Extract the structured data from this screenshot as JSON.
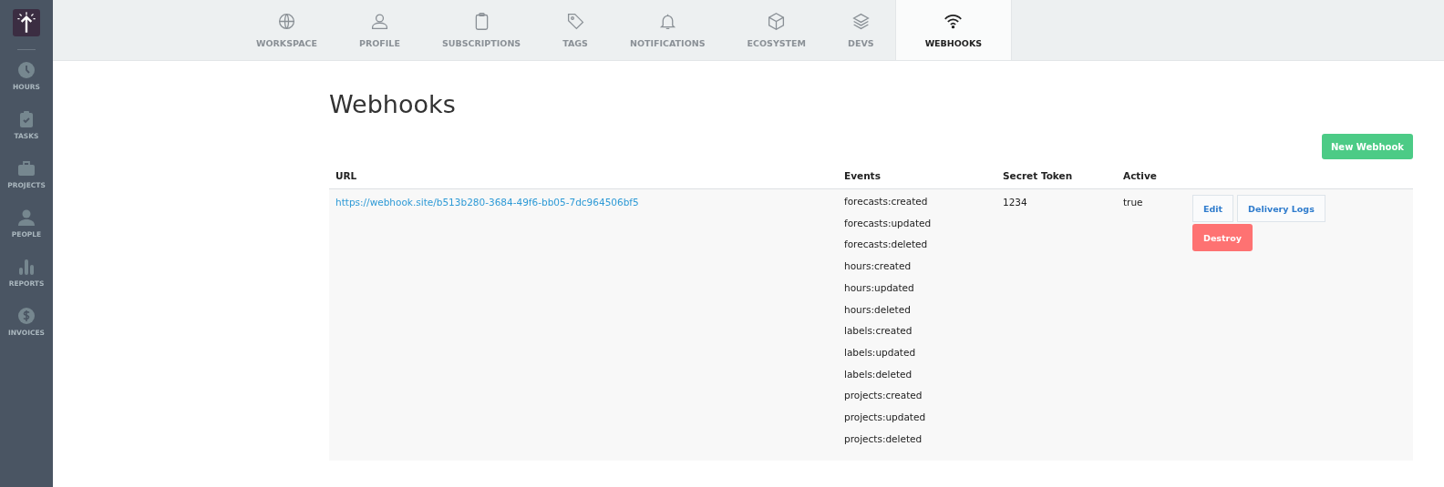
{
  "sidebar": {
    "items": [
      {
        "label": "HOURS"
      },
      {
        "label": "TASKS"
      },
      {
        "label": "PROJECTS"
      },
      {
        "label": "PEOPLE"
      },
      {
        "label": "REPORTS"
      },
      {
        "label": "INVOICES"
      }
    ]
  },
  "tabs": [
    {
      "label": "WORKSPACE",
      "selected": false
    },
    {
      "label": "PROFILE",
      "selected": false
    },
    {
      "label": "SUBSCRIPTIONS",
      "selected": false
    },
    {
      "label": "TAGS",
      "selected": false
    },
    {
      "label": "NOTIFICATIONS",
      "selected": false
    },
    {
      "label": "ECOSYSTEM",
      "selected": false
    },
    {
      "label": "DEVS",
      "selected": false
    },
    {
      "label": "WEBHOOKS",
      "selected": true
    }
  ],
  "page_title": "Webhooks",
  "new_button": "New Webhook",
  "table": {
    "columns": [
      "URL",
      "Events",
      "Secret Token",
      "Active"
    ],
    "rows": [
      {
        "url": "https://webhook.site/b513b280-3684-49f6-bb05-7dc964506bf5",
        "events": [
          "forecasts:created",
          "forecasts:updated",
          "forecasts:deleted",
          "hours:created",
          "hours:updated",
          "hours:deleted",
          "labels:created",
          "labels:updated",
          "labels:deleted",
          "projects:created",
          "projects:updated",
          "projects:deleted"
        ],
        "secret_token": "1234",
        "active": "true",
        "actions": [
          {
            "label": "Edit",
            "kind": "plain"
          },
          {
            "label": "Delivery Logs",
            "kind": "plain"
          },
          {
            "label": "Destroy",
            "kind": "danger"
          }
        ]
      }
    ]
  }
}
